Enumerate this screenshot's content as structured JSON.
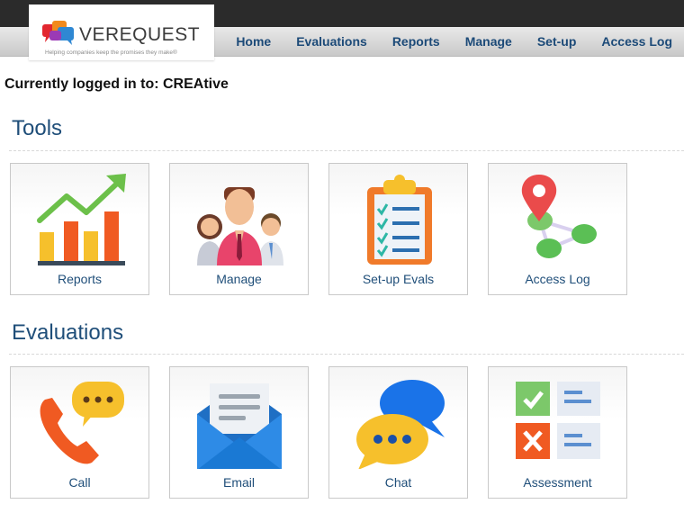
{
  "header": {
    "brand": "VEREQUEST",
    "tagline": "Helping companies keep the promises they make®",
    "nav": [
      {
        "label": "Home"
      },
      {
        "label": "Evaluations"
      },
      {
        "label": "Reports"
      },
      {
        "label": "Manage"
      },
      {
        "label": "Set-up"
      },
      {
        "label": "Access Log"
      }
    ]
  },
  "status": {
    "logged_in": "Currently logged in to: CREAtive"
  },
  "tools": {
    "title": "Tools",
    "tiles": [
      {
        "label": "Reports",
        "icon": "bar-chart-icon"
      },
      {
        "label": "Manage",
        "icon": "people-icon"
      },
      {
        "label": "Set-up Evals",
        "icon": "clipboard-checklist-icon"
      },
      {
        "label": "Access Log",
        "icon": "map-pin-network-icon"
      }
    ]
  },
  "evaluations": {
    "title": "Evaluations",
    "tiles": [
      {
        "label": "Call",
        "icon": "phone-chat-icon"
      },
      {
        "label": "Email",
        "icon": "envelope-icon"
      },
      {
        "label": "Chat",
        "icon": "chat-bubbles-icon"
      },
      {
        "label": "Assessment",
        "icon": "assessment-checklist-icon"
      }
    ]
  },
  "colors": {
    "nav_text": "#1c4a78",
    "section_title": "#1f4e79",
    "top_bar": "#2b2b2b"
  }
}
